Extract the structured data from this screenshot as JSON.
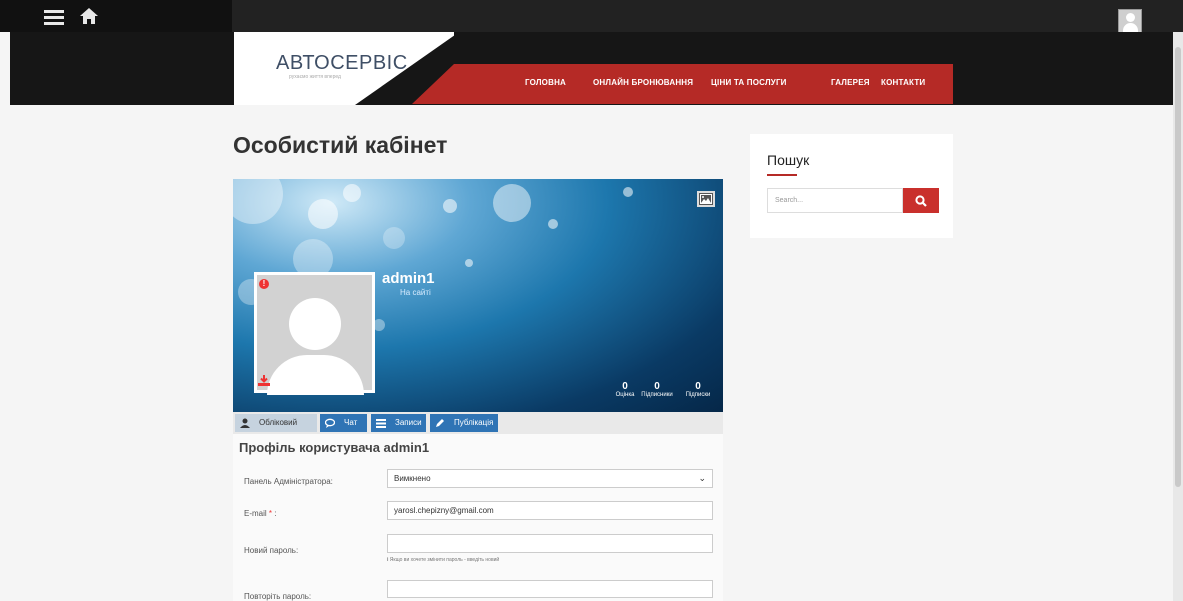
{
  "brand": {
    "name": "АВТОСЕРВІС",
    "tagline": "рухаємо життя вперед"
  },
  "nav": [
    "ГОЛОВНА",
    "ОНЛАЙН БРОНЮВАННЯ",
    "ЦІНИ ТА ПОСЛУГИ",
    "ГАЛЕРЕЯ",
    "КОНТАКТИ"
  ],
  "page": {
    "title": "Особистий кабінет"
  },
  "profile": {
    "username": "admin1",
    "status": "На сайті",
    "stats": [
      {
        "value": "0",
        "label": "Оцінка"
      },
      {
        "value": "0",
        "label": "Підписники"
      },
      {
        "value": "0",
        "label": "Підписки"
      }
    ]
  },
  "tabs": [
    "Обліковий запис",
    "Чат",
    "Записи",
    "Публікація"
  ],
  "form": {
    "title": "Профіль користувача admin1",
    "admin_panel": {
      "label": "Панель Адміністратора:",
      "value": "Вимкнено"
    },
    "email": {
      "label": "E-mail",
      "required": "*",
      "suffix": ":",
      "value": "yarosl.chepizny@gmail.com"
    },
    "new_password": {
      "label": "Новий пароль:",
      "hint": "Якщо ви хочете змінити пароль - введіть новий"
    },
    "repeat_password": {
      "label": "Повторіть пароль:"
    }
  },
  "search": {
    "title": "Пошук",
    "placeholder": "Search..."
  },
  "icons": {
    "menu": "menu-icon",
    "home": "home-icon",
    "search": "search-icon",
    "camera": "image-icon"
  },
  "colors": {
    "accent": "#b52a26",
    "tab_blue": "#2f74b5",
    "header": "#161616"
  }
}
